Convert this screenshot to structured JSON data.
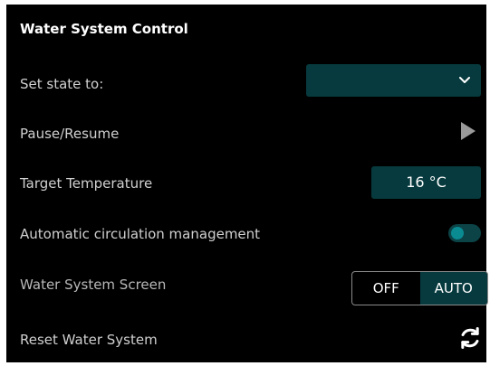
{
  "panel": {
    "title": "Water System Control",
    "rows": {
      "set_state": {
        "label": "Set state to:",
        "value": "",
        "icon": "chevron-down-icon"
      },
      "pause_resume": {
        "label": "Pause/Resume",
        "icon": "play-icon"
      },
      "target_temperature": {
        "label": "Target Temperature",
        "value": "16 °C"
      },
      "auto_circulation": {
        "label": "Automatic circulation management",
        "state": "off"
      },
      "screen": {
        "label": "Water System Screen",
        "options": [
          "OFF",
          "AUTO"
        ],
        "selected": "AUTO"
      },
      "reset": {
        "label": "Reset Water System",
        "icon": "refresh-icon"
      }
    }
  },
  "colors": {
    "background": "#000000",
    "control_fill": "#073a3e",
    "toggle_knob": "#0a8b92",
    "text": "#d0d0d0"
  }
}
